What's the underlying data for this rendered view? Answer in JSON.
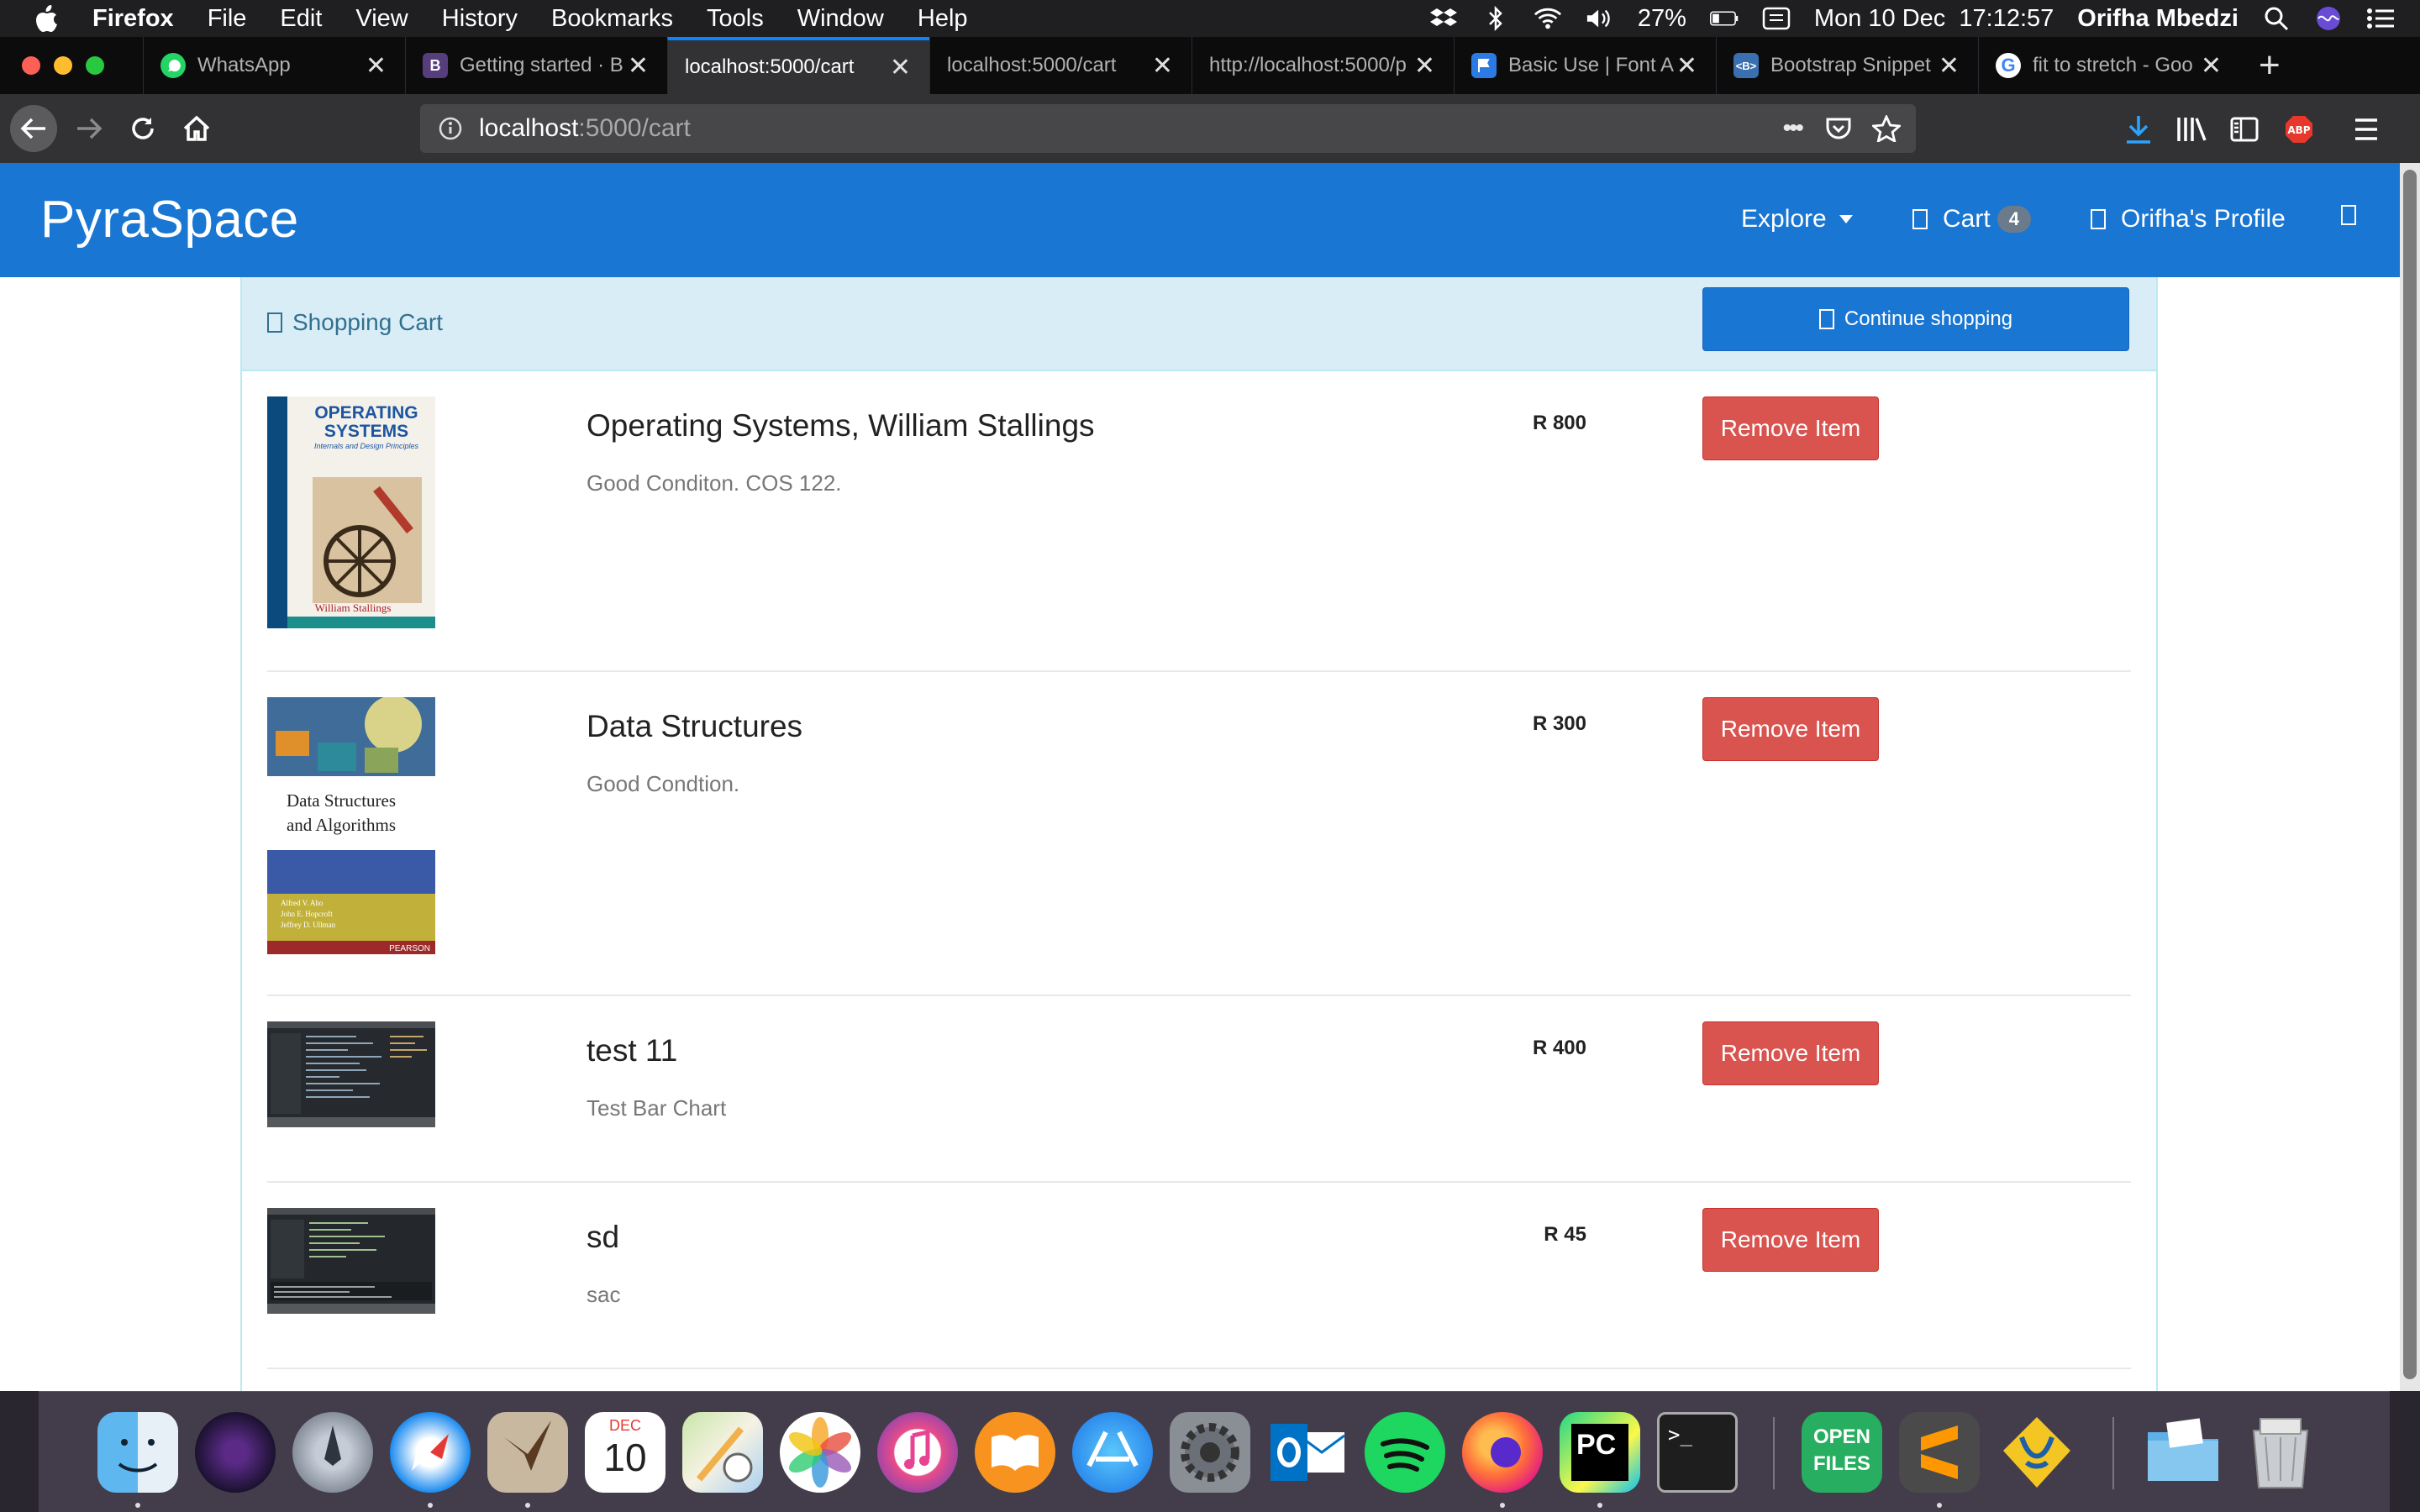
{
  "menubar": {
    "app_name": "Firefox",
    "items": [
      "File",
      "Edit",
      "View",
      "History",
      "Bookmarks",
      "Tools",
      "Window",
      "Help"
    ],
    "battery": "27%",
    "datetime": "Mon 10 Dec  17:12:57",
    "user": "Orifha Mbedzi"
  },
  "browser": {
    "tabs": [
      {
        "title": "WhatsApp",
        "favicon": "whatsapp-icon",
        "color": "#25d366"
      },
      {
        "title": "Getting started · B",
        "favicon": "bootstrap-icon",
        "color": "#563d7c"
      },
      {
        "title": "localhost:5000/cart",
        "favicon": "",
        "color": ""
      },
      {
        "title": "localhost:5000/cart",
        "favicon": "",
        "color": ""
      },
      {
        "title": "http://localhost:5000/p",
        "favicon": "",
        "color": ""
      },
      {
        "title": "Basic Use | Font A",
        "favicon": "font-awesome-flag-icon",
        "color": "#2c7be5"
      },
      {
        "title": "Bootstrap Snippet",
        "favicon": "bootsnipp-icon",
        "color": "#3a6fb0"
      },
      {
        "title": "fit to stretch - Goo",
        "favicon": "google-icon",
        "color": "#ffffff"
      }
    ],
    "active_tab": 2,
    "url_host": "localhost",
    "url_path": ":5000/cart",
    "more_label": "•••"
  },
  "site": {
    "brand": "PyraSpace",
    "nav": {
      "explore": "Explore",
      "cart": "Cart",
      "cart_count": "4",
      "profile": "Orifha's Profile"
    },
    "panel_title": "Shopping Cart",
    "continue_label": "Continue shopping",
    "remove_label": "Remove Item",
    "items": [
      {
        "name": "Operating Systems, William Stallings",
        "desc": "Good Conditon. COS 122.",
        "price": "R 800",
        "cover_title": "OPERATING SYSTEMS",
        "cover_sub": "Internals and Design Principles",
        "cover_author": "William Stallings"
      },
      {
        "name": "Data Structures",
        "desc": "Good Condtion.",
        "price": "R 300",
        "cover_title": "Data Structures and Algorithms",
        "cover_authors": "Alfred V. Aho John E. Hopcroft Jeffrey D. Ullman",
        "cover_publisher": "PEARSON"
      },
      {
        "name": "test 11",
        "desc": "Test Bar Chart",
        "price": "R 400"
      },
      {
        "name": "sd",
        "desc": "sac",
        "price": "R 45"
      }
    ]
  },
  "dock": {
    "apps": [
      "finder",
      "siri",
      "launchpad",
      "safari",
      "mail-eagle",
      "calendar",
      "maps",
      "photos",
      "itunes",
      "ibooks",
      "app-store",
      "system-preferences",
      "outlook",
      "spotify",
      "firefox",
      "pycharm",
      "terminal",
      "open-files",
      "sublime-text",
      "cyberduck",
      "downloads-folder",
      "trash"
    ],
    "calendar_month": "DEC",
    "calendar_day": "10",
    "open_files_label": "OPEN FILES"
  }
}
